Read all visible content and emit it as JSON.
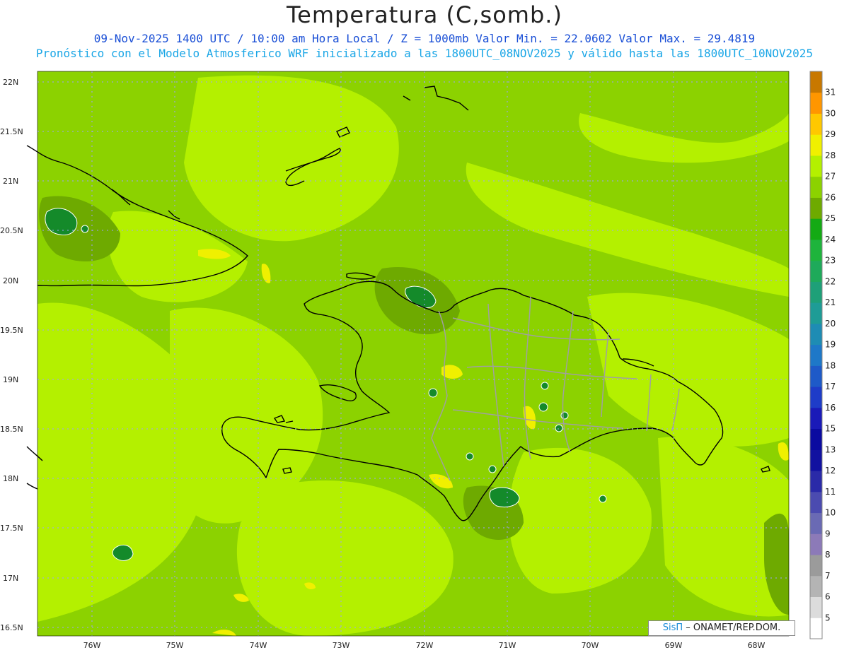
{
  "title": "Temperatura (C,somb.)",
  "subtitle_line1": "09-Nov-2025 1400 UTC / 10:00 am Hora Local / Z = 1000mb  Valor Min. = 22.0602  Valor Max. = 29.4819",
  "subtitle_line2": "Pronóstico con el Modelo Atmosferico WRF inicializado a las 1800UTC_08NOV2025 y válido hasta las  1800UTC_10NOV2025",
  "credit": {
    "brand": "SisΠ",
    "text": "– ONAMET/REP.DOM."
  },
  "axes": {
    "lat_labels": [
      "22N",
      "21.5N",
      "21N",
      "20.5N",
      "20N",
      "19.5N",
      "19N",
      "18.5N",
      "18N",
      "17.5N",
      "17N",
      "16.5N"
    ],
    "lon_labels": [
      "76W",
      "75W",
      "74W",
      "73W",
      "72W",
      "71W",
      "70W",
      "69W",
      "68W"
    ],
    "lat_range": [
      16.5,
      22.1
    ],
    "lon_range": [
      -76.65,
      -67.6
    ]
  },
  "colorbar": {
    "levels": [
      5,
      6,
      7,
      8,
      9,
      10,
      11,
      12,
      13,
      15,
      16,
      17,
      18,
      19,
      20,
      21,
      22,
      23,
      24,
      25,
      26,
      27,
      28,
      29,
      30,
      31
    ],
    "colors": [
      "#ffffff",
      "#dcdcdc",
      "#b4b4b4",
      "#9b9b9b",
      "#8c7ab8",
      "#6a6ab4",
      "#4b4bb0",
      "#2a2aa8",
      "#1111a0",
      "#0a0aa0",
      "#1a1ab8",
      "#1e3cc8",
      "#1e5ac8",
      "#1e78c8",
      "#1e8cb4",
      "#1e9c96",
      "#1ea078",
      "#1eaa5a",
      "#1eb43c",
      "#14aa14",
      "#6eaa00",
      "#8cd200",
      "#b4f000",
      "#f0f000",
      "#ffc800",
      "#ff9600",
      "#c87800"
    ],
    "range": [
      5,
      32
    ]
  },
  "field": {
    "variable": "Temperatura",
    "units": "C",
    "level": "1000mb",
    "min": 22.0602,
    "max": 29.4819
  },
  "colors": {
    "band_26": "#8cd200",
    "band_27": "#b4f000",
    "band_25": "#6eaa00",
    "band_24": "#148a2a",
    "band_28": "#f0f000",
    "coast": "#000000",
    "borders": "#a0a0a0"
  }
}
